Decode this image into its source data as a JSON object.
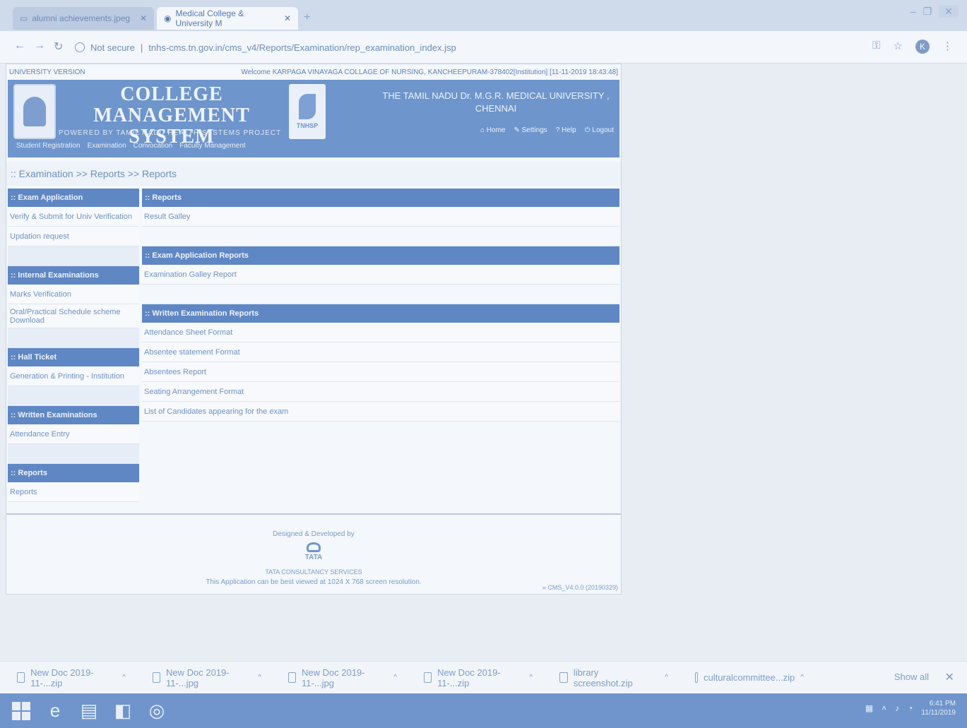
{
  "browser": {
    "tabs": [
      {
        "label": "alumni achievements.jpeg"
      },
      {
        "label": "Medical College & University M"
      }
    ],
    "url_security": "Not secure",
    "url": "tnhs-cms.tn.gov.in/cms_v4/Reports/Examination/rep_examination_index.jsp",
    "avatar_letter": "K"
  },
  "app": {
    "version_label": "UNIVERSITY VERSION",
    "welcome": "Welcome KARPAGA VINAYAGA COLLAGE OF NURSING, KANCHEEPURAM-378402[Institution] [11-11-2019 18:43:48]",
    "title_line1": "COLLEGE MANAGEMENT",
    "title_line2": "SYSTEM",
    "powered_by": "POWERED BY TAMIL NADU HEALTH SYSTEMS PROJECT",
    "leaf_logo_text": "TNHSP",
    "university_line1": "THE TAMIL NADU Dr. M.G.R. MEDICAL UNIVERSITY ,",
    "university_line2": "CHENNAI",
    "header_links": {
      "home": "Home",
      "settings": "Settings",
      "help": "Help",
      "logout": "Logout"
    },
    "menu": [
      "Student Registration",
      "Examination",
      "Convocation",
      "Faculty Management"
    ]
  },
  "breadcrumb": ":: Examination >> Reports >> Reports",
  "left_menu": {
    "exam_application": {
      "header": ":: Exam Application",
      "items": [
        "Verify & Submit for Univ Verification",
        "Updation request"
      ]
    },
    "internal_examinations": {
      "header": ":: Internal Examinations",
      "items": [
        "Marks Verification",
        "Oral/Practical Schedule scheme Download"
      ]
    },
    "hall_ticket": {
      "header": ":: Hall Ticket",
      "items": [
        "Generation & Printing - Institution"
      ]
    },
    "written_examinations": {
      "header": ":: Written Examinations",
      "items": [
        "Attendance Entry"
      ]
    },
    "reports": {
      "header": ":: Reports",
      "items": [
        "Reports"
      ]
    }
  },
  "right_panel": {
    "reports": {
      "header": ":: Reports",
      "items": [
        "Result Galley"
      ]
    },
    "exam_application_reports": {
      "header": ":: Exam Application Reports",
      "items": [
        "Examination Galley Report"
      ]
    },
    "written_examination_reports": {
      "header": ":: Written Examination Reports",
      "items": [
        "Attendance Sheet Format",
        "Absentee statement Format",
        "Absentees Report",
        "Seating Arrangement Format",
        "List of Candidates appearing for the exam"
      ]
    }
  },
  "footer": {
    "designed_by": "Designed & Developed by",
    "tata": "TATA",
    "tcs": "TATA CONSULTANCY SERVICES",
    "best_viewed": "This Application can be best viewed at 1024 X 768 screen resolution.",
    "version_note": "» CMS_V4.0.0 (20190329)"
  },
  "downloads": {
    "items": [
      "New Doc 2019-11-...zip",
      "New Doc 2019-11-...jpg",
      "New Doc 2019-11-...jpg",
      "New Doc 2019-11-...zip",
      "library screenshot.zip",
      "culturalcommittee...zip"
    ],
    "show_all": "Show all"
  },
  "taskbar": {
    "time": "6:41 PM",
    "date": "11/11/2019"
  },
  "colors": {
    "accent": "#5f87c4",
    "banner": "#6e95cc",
    "page_bg": "#f4f7fb"
  }
}
